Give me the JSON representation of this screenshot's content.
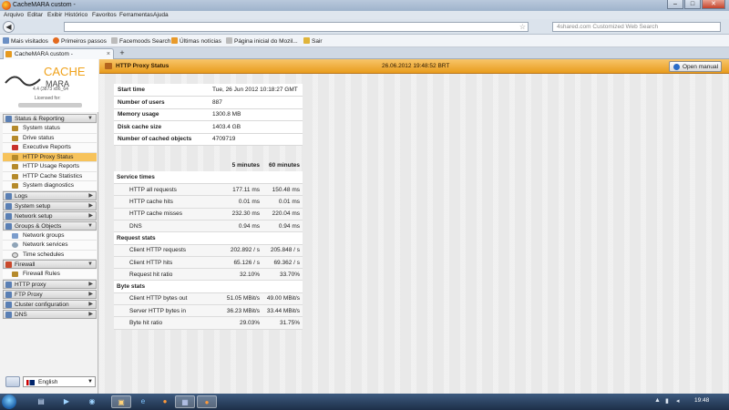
{
  "window": {
    "title": "CacheMARA custom -",
    "minimize": "–",
    "maximize": "□",
    "close": "✕"
  },
  "menu": [
    "Arquivo",
    "Editar",
    "Exibir",
    "Histórico",
    "Favoritos",
    "Ferramentas",
    "Ajuda"
  ],
  "search": {
    "placeholder": "4shared.com Customized Web Search"
  },
  "bookmarks": [
    "Mais visitados",
    "Primeiros passos",
    "Facemoods Search",
    "Últimas notícias",
    "Página inicial do Mozil...",
    "Sair"
  ],
  "tab": {
    "label": "CacheMARA custom -",
    "close": "×",
    "new": "+"
  },
  "logo": {
    "word1": "CACHE",
    "word2": "MARA",
    "version": "4.4 (3873 x86_64",
    "licensed": "Licensed for:"
  },
  "sidebar": {
    "sections": [
      {
        "label": "Status & Reporting",
        "open": true,
        "items": [
          "System status",
          "Drive status",
          "Executive Reports",
          "HTTP Proxy Status",
          "HTTP Usage Reports",
          "HTTP Cache Statistics",
          "System diagnostics"
        ]
      },
      {
        "label": "Logs",
        "open": false,
        "items": []
      },
      {
        "label": "System setup",
        "open": false,
        "items": []
      },
      {
        "label": "Network setup",
        "open": false,
        "items": []
      },
      {
        "label": "Groups & Objects",
        "open": true,
        "items": [
          "Network groups",
          "Network services",
          "Time schedules"
        ]
      },
      {
        "label": "Firewall",
        "open": true,
        "items": [
          "Firewall Rules"
        ]
      },
      {
        "label": "HTTP proxy",
        "open": false,
        "items": []
      },
      {
        "label": "FTP Proxy",
        "open": false,
        "items": []
      },
      {
        "label": "Cluster configuration",
        "open": false,
        "items": []
      },
      {
        "label": "DNS",
        "open": false,
        "items": []
      }
    ],
    "active": "HTTP Proxy Status",
    "language": "English"
  },
  "header": {
    "title": "HTTP Proxy Status",
    "datetime": "26.06.2012 19:48:52 BRT",
    "manual": "Open manual"
  },
  "info": [
    {
      "label": "Start time",
      "value": "Tue, 26 Jun 2012 10:18:27 GMT"
    },
    {
      "label": "Number of users",
      "value": "887"
    },
    {
      "label": "Memory usage",
      "value": "1300.8 MB"
    },
    {
      "label": "Disk cache size",
      "value": "1403.4 GB"
    },
    {
      "label": "Number of cached objects",
      "value": "4709719"
    }
  ],
  "stats": {
    "col1": "5 minutes",
    "col2": "60 minutes",
    "groups": [
      {
        "label": "Service times",
        "rows": [
          {
            "label": "HTTP all requests",
            "v5": "177.11 ms",
            "v60": "150.48 ms"
          },
          {
            "label": "HTTP cache hits",
            "v5": "0.01 ms",
            "v60": "0.01 ms"
          },
          {
            "label": "HTTP cache misses",
            "v5": "232.30 ms",
            "v60": "220.04 ms"
          },
          {
            "label": "DNS",
            "v5": "0.94 ms",
            "v60": "0.94 ms"
          }
        ]
      },
      {
        "label": "Request stats",
        "rows": [
          {
            "label": "Client HTTP requests",
            "v5": "202.892 / s",
            "v60": "205.848 / s"
          },
          {
            "label": "Client HTTP hits",
            "v5": "65.126 / s",
            "v60": "69.362 / s"
          },
          {
            "label": "Request hit ratio",
            "v5": "32.10%",
            "v60": "33.70%"
          }
        ]
      },
      {
        "label": "Byte stats",
        "rows": [
          {
            "label": "Client HTTP bytes out",
            "v5": "51.05 MBit/s",
            "v60": "49.00 MBit/s"
          },
          {
            "label": "Server HTTP bytes in",
            "v5": "36.23 MBit/s",
            "v60": "33.44 MBit/s"
          },
          {
            "label": "Byte hit ratio",
            "v5": "29.03%",
            "v60": "31.75%"
          }
        ]
      }
    ]
  },
  "taskbar": {
    "clock": "19:48"
  }
}
